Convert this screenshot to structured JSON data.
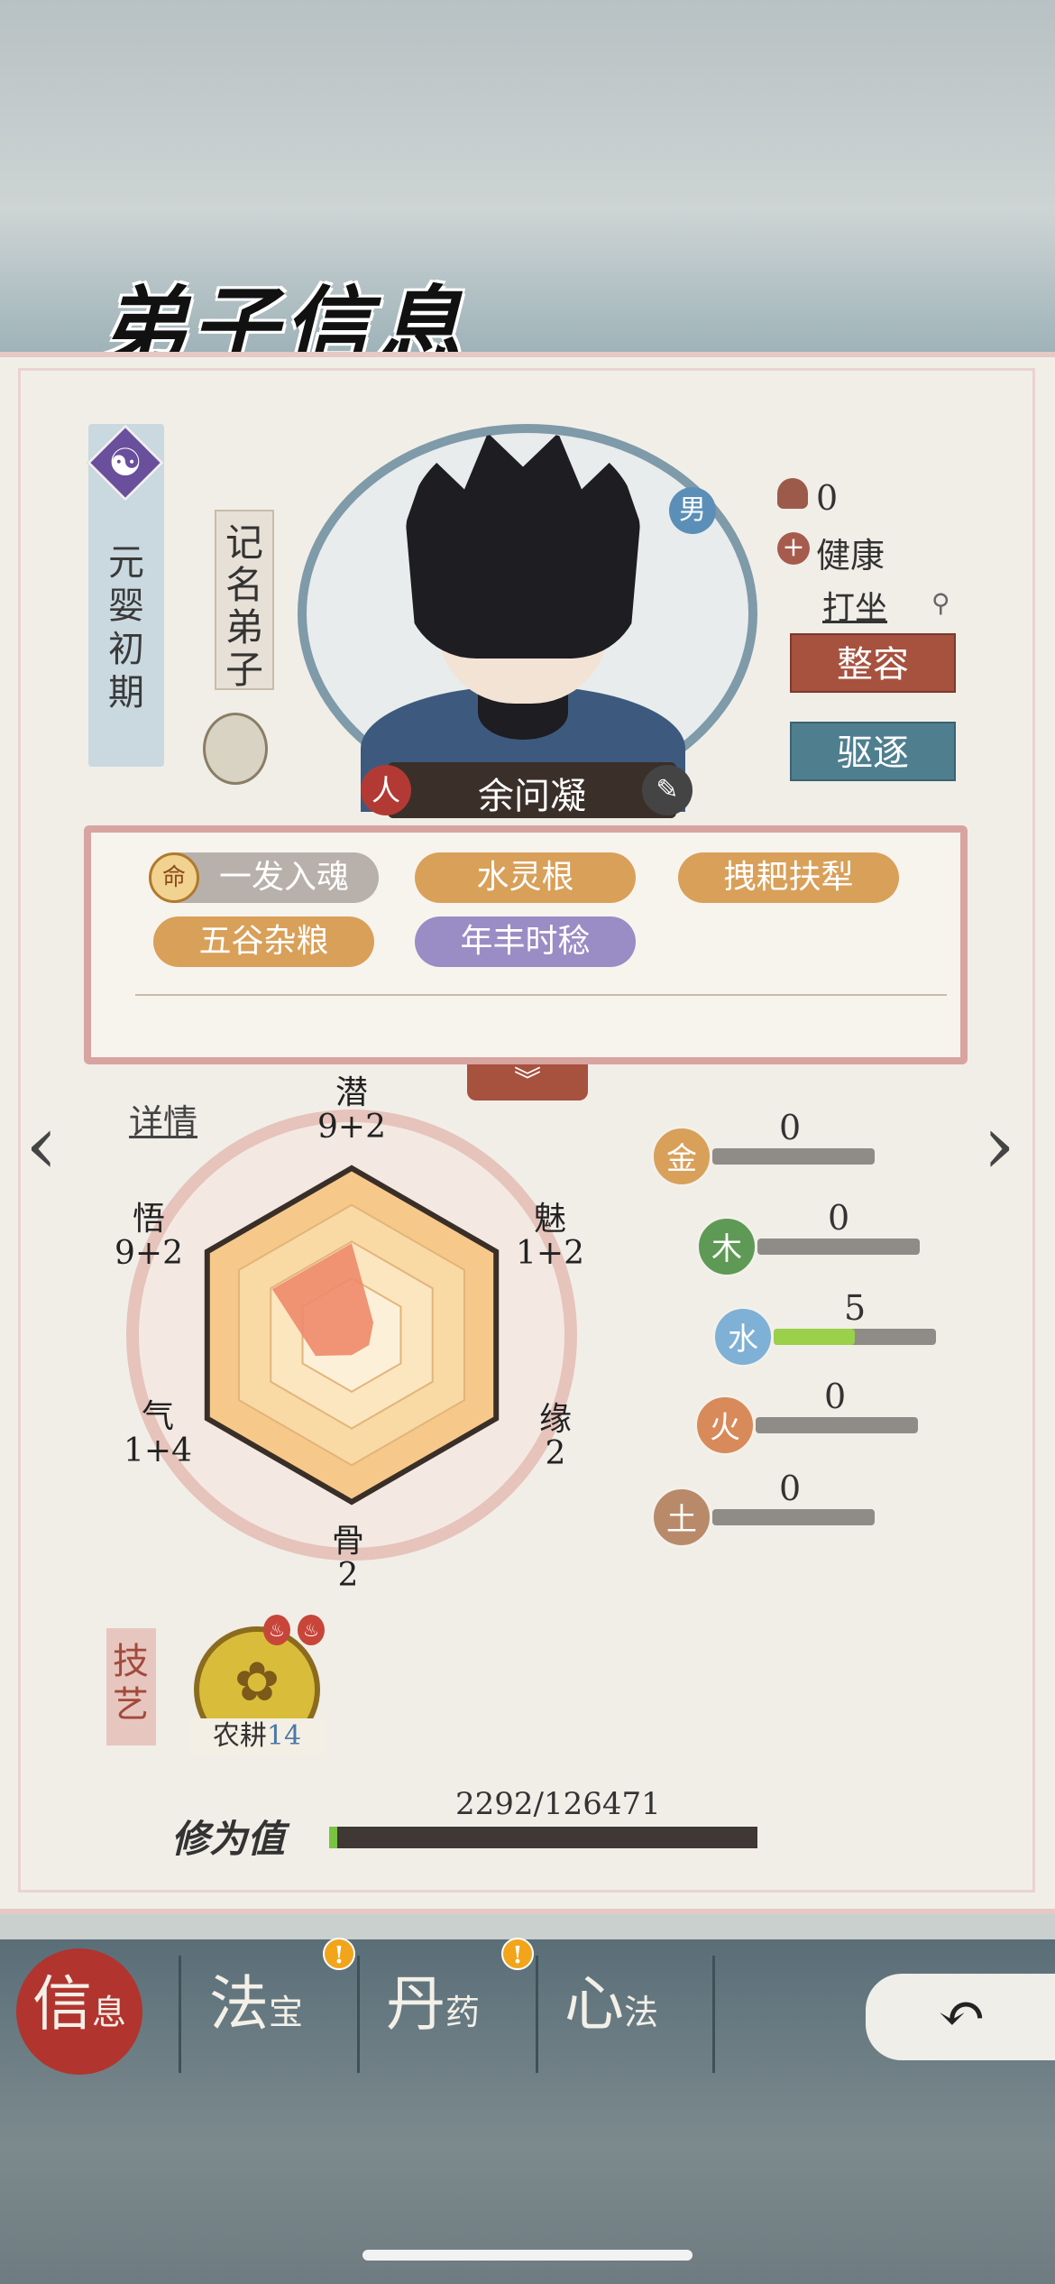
{
  "title": "弟子信息",
  "disciple": {
    "realm": "元婴初期",
    "rank": "记名弟子",
    "name": "余问凝",
    "gender": "男",
    "race_badge": "人"
  },
  "status": {
    "mushroom_count": "0",
    "health": "健康",
    "activity": "打坐"
  },
  "actions": {
    "face_label": "整容",
    "expel_label": "驱逐"
  },
  "traits": [
    {
      "label": "一发入魂",
      "icon": "命",
      "style": "gray"
    },
    {
      "label": "水灵根",
      "style": "gold"
    },
    {
      "label": "拽耙扶犁",
      "style": "gold"
    },
    {
      "label": "五谷杂粮",
      "style": "gold"
    },
    {
      "label": "年丰时稔",
      "style": "purple"
    }
  ],
  "detail_label": "详情",
  "attributes": {
    "qian": {
      "name": "潜",
      "value": "9+2"
    },
    "mei": {
      "name": "魅",
      "value": "1+2"
    },
    "yuan": {
      "name": "缘",
      "value": "2"
    },
    "gu": {
      "name": "骨",
      "value": "2"
    },
    "qi": {
      "name": "气",
      "value": "1+4"
    },
    "wu": {
      "name": "悟",
      "value": "9+2"
    }
  },
  "elements": [
    {
      "name": "金",
      "value": "0",
      "fraction": 0,
      "color": "#d9a05a"
    },
    {
      "name": "木",
      "value": "0",
      "fraction": 0,
      "color": "#5e9a55"
    },
    {
      "name": "水",
      "value": "5",
      "fraction": 0.5,
      "color": "#7fb0d6"
    },
    {
      "name": "火",
      "value": "0",
      "fraction": 0,
      "color": "#d98a5a"
    },
    {
      "name": "土",
      "value": "0",
      "fraction": 0,
      "color": "#b98a6a"
    }
  ],
  "skill": {
    "tab_label": "技艺",
    "name": "农耕",
    "level": "14"
  },
  "cultivation": {
    "label": "修为值",
    "current": 2292,
    "max": 126471,
    "text": "2292/126471"
  },
  "nav": {
    "info": {
      "big": "信",
      "small": "息"
    },
    "treasure": {
      "big": "法",
      "small": "宝"
    },
    "pill": {
      "big": "丹",
      "small": "药"
    },
    "method": {
      "big": "心",
      "small": "法"
    },
    "badge": "!"
  },
  "colors": {
    "accent_red": "#a7513f",
    "accent_teal": "#4f7f8f",
    "radar_fill": "#ee8a6a"
  }
}
